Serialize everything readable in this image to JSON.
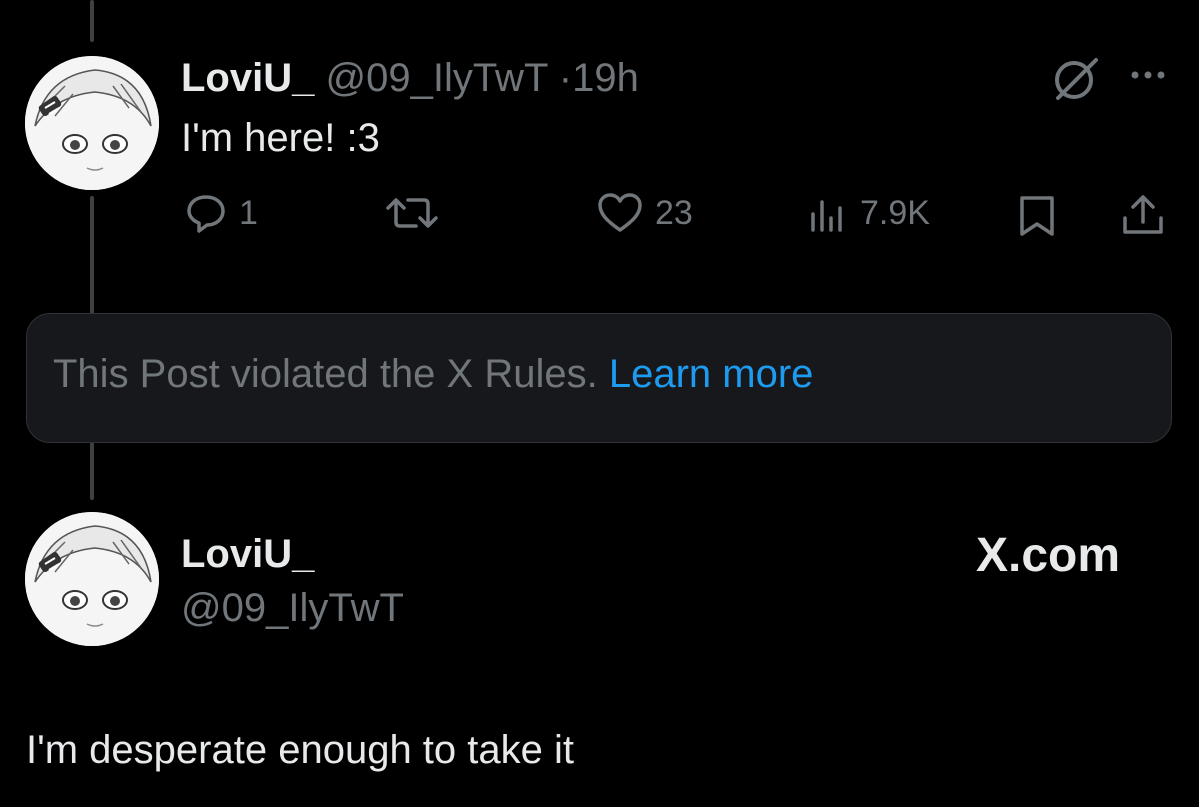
{
  "post": {
    "display_name": "LoviU_",
    "handle": "@09_IlyTwT",
    "separator": "·",
    "time": "19h",
    "text": "I'm here! :3",
    "actions": {
      "replies": "1",
      "likes": "23",
      "views": "7.9K"
    }
  },
  "notice": {
    "text": "This Post violated the X Rules.",
    "link": "Learn more"
  },
  "card": {
    "display_name": "LoviU_",
    "handle": "@09_IlyTwT",
    "brand": "X.com",
    "text": "I'm desperate enough to take it"
  },
  "icons": [
    "grok-icon",
    "more-icon",
    "reply-icon",
    "repost-icon",
    "like-icon",
    "views-icon",
    "bookmark-icon",
    "share-icon"
  ],
  "colors": {
    "background": "#000000",
    "text": "#e7e9ea",
    "muted": "#71767b",
    "link": "#1d9bf0",
    "notice_bg": "#16181c"
  }
}
